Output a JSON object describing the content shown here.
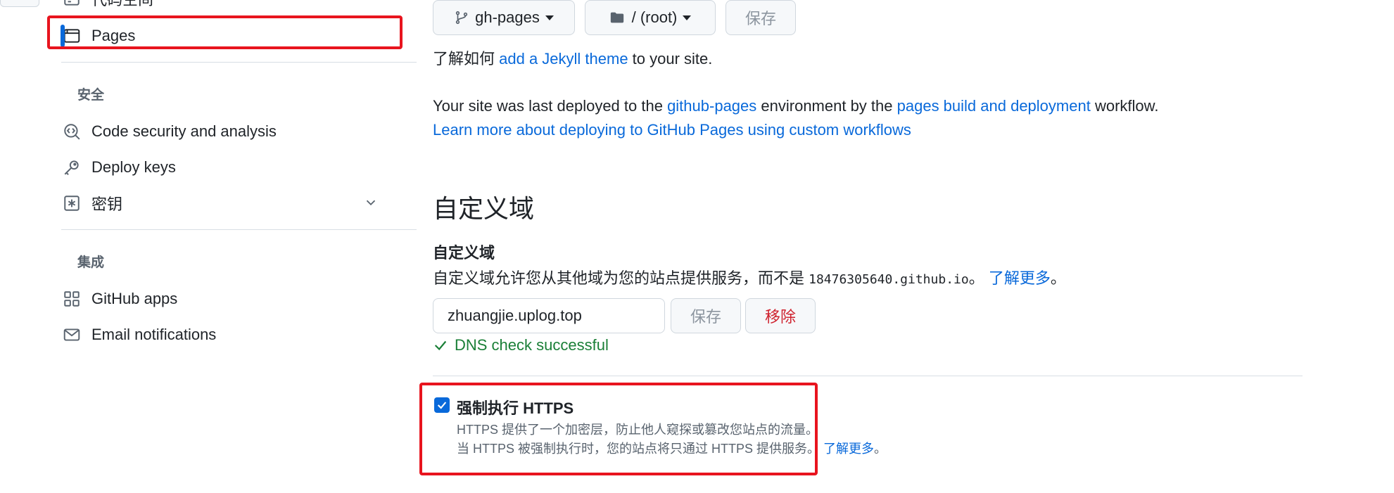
{
  "sidebar": {
    "partial_top_label": "代码空间",
    "pages_label": "Pages",
    "security_group_title": "安全",
    "security_items": [
      {
        "label": "Code security and analysis",
        "icon": "codescan-icon"
      },
      {
        "label": "Deploy keys",
        "icon": "key-icon"
      },
      {
        "label": "密钥",
        "icon": "asterisk-icon"
      }
    ],
    "integrations_group_title": "集成",
    "integration_items": [
      {
        "label": "GitHub apps",
        "icon": "apps-icon"
      },
      {
        "label": "Email notifications",
        "icon": "mail-icon"
      }
    ]
  },
  "source": {
    "branch_label": "gh-pages",
    "folder_label": "/ (root)",
    "save_label": "保存"
  },
  "theme_line": {
    "prefix": "了解如何 ",
    "link": "add a Jekyll theme",
    "suffix": " to your site."
  },
  "deploy_line": {
    "p1": "Your site was last deployed to the ",
    "link1": "github-pages",
    "p2": " environment by the ",
    "link2": "pages build and deployment",
    "p3": " workflow.",
    "learn_more": "Learn more about deploying to GitHub Pages using custom workflows"
  },
  "custom_domain": {
    "section_title": "自定义域",
    "field_label": "自定义域",
    "description_prefix": "自定义域允许您从其他域为您的站点提供服务，而不是 ",
    "default_domain": "18476305640.github.io",
    "description_sep": "。 ",
    "learn_more": "了解更多",
    "description_end": "。",
    "input_value": "zhuangjie.uplog.top",
    "save_label": "保存",
    "remove_label": "移除",
    "dns_status": "DNS check successful"
  },
  "https": {
    "checked": true,
    "label": "强制执行 HTTPS",
    "desc1": "HTTPS 提供了一个加密层，防止他人窥探或篡改您站点的流量。",
    "desc2_prefix": "当 HTTPS 被强制执行时，您的站点将只通过 HTTPS 提供服务。 ",
    "learn_more": "了解更多",
    "desc2_end": "。"
  },
  "colors": {
    "accent": "#0969da",
    "success": "#1a7f37",
    "danger": "#cf222e",
    "annotation": "#e8141e"
  }
}
